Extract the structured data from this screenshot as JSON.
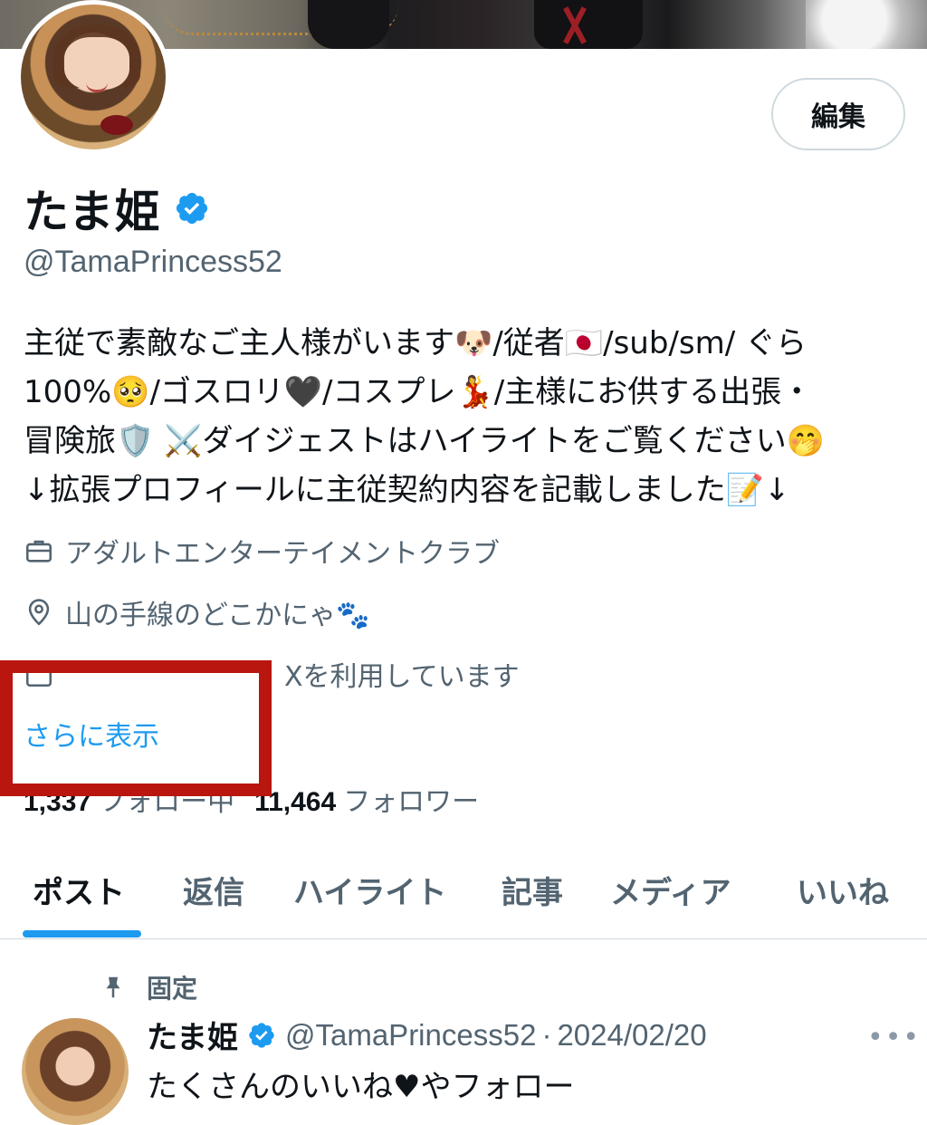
{
  "profile": {
    "edit_label": "編集",
    "display_name": "たま姫",
    "handle": "@TamaPrincess52",
    "bio_lines": [
      "主従で素敵なご主人様がいます🐶/従者🇯🇵/sub/sm/ ぐら",
      "100%🥺/ゴスロリ🖤/コスプレ💃/主様にお供する出張・",
      "冒険旅🛡️ ⚔️ダイジェストはハイライトをご覧ください🤭",
      "↓拡張プロフィールに主従契約内容を記載しました📝↓"
    ],
    "category": "アダルトエンターテイメントクラブ",
    "location": "山の手線のどこかにゃ🐾",
    "joined": "Xを利用しています",
    "show_more": "さらに表示",
    "following_count": "1,337",
    "following_label": "フォロー中",
    "followers_count": "11,464",
    "followers_label": "フォロワー"
  },
  "tabs": [
    {
      "label": "ポスト",
      "active": true
    },
    {
      "label": "返信",
      "active": false
    },
    {
      "label": "ハイライト",
      "active": false
    },
    {
      "label": "記事",
      "active": false
    },
    {
      "label": "メディア",
      "active": false
    },
    {
      "label": "いいね",
      "active": false
    }
  ],
  "pinned_post": {
    "pinned_label": "固定",
    "author_name": "たま姫",
    "author_handle": "@TamaPrincess52",
    "separator": "·",
    "date": "2024/02/20",
    "more": "•••",
    "text": "たくさんのいいね♥やフォロー"
  },
  "colors": {
    "accent": "#1d9bf0",
    "annotation_box": "#b9160f",
    "secondary_text": "#536471"
  },
  "icons": [
    "verified-badge-icon",
    "briefcase-icon",
    "location-pin-icon",
    "calendar-icon",
    "pin-icon",
    "more-icon"
  ]
}
